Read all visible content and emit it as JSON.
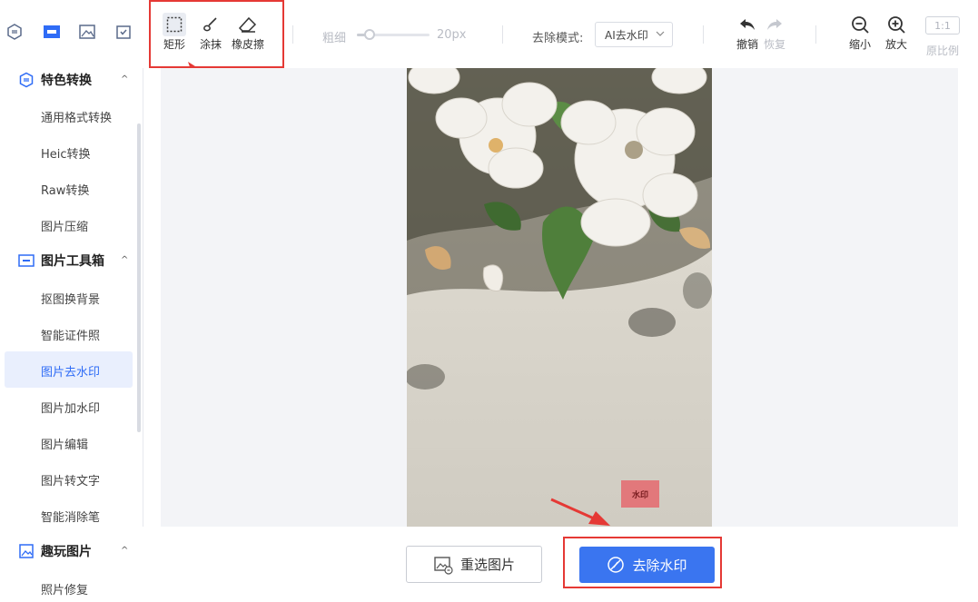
{
  "sidebar": {
    "top_icons": [
      "convert-icon",
      "toolbox-icon",
      "image-icon",
      "check-image-icon"
    ],
    "sections": [
      {
        "label": "特色转换",
        "icon": "convert-icon",
        "items": [
          "通用格式转换",
          "Heic转换",
          "Raw转换",
          "图片压缩"
        ]
      },
      {
        "label": "图片工具箱",
        "icon": "toolbox-icon",
        "items": [
          "抠图换背景",
          "智能证件照",
          "图片去水印",
          "图片加水印",
          "图片编辑",
          "图片转文字",
          "智能消除笔"
        ]
      },
      {
        "label": "趣玩图片",
        "icon": "image-icon",
        "items": [
          "照片修复"
        ]
      }
    ],
    "active_item": "图片去水印",
    "accent": "#2f6cf6"
  },
  "toolbar": {
    "tools": [
      {
        "label": "矩形",
        "icon": "rectangle-select-icon",
        "selected": true
      },
      {
        "label": "涂抹",
        "icon": "brush-icon",
        "selected": false
      },
      {
        "label": "橡皮擦",
        "icon": "eraser-icon",
        "selected": false
      }
    ],
    "thickness_label": "粗细",
    "thickness_value": "20px",
    "mode_label": "去除模式:",
    "mode_value": "AI去水印",
    "undo_label": "撤销",
    "redo_label": "恢复",
    "zoom_out_label": "缩小",
    "zoom_in_label": "放大",
    "ratio_badge": "1:1",
    "ratio_label": "原比例"
  },
  "canvas": {
    "watermark_text": "水印"
  },
  "actions": {
    "reselect_label": "重选图片",
    "remove_label": "去除水印",
    "remove_color": "#3a75f0"
  }
}
